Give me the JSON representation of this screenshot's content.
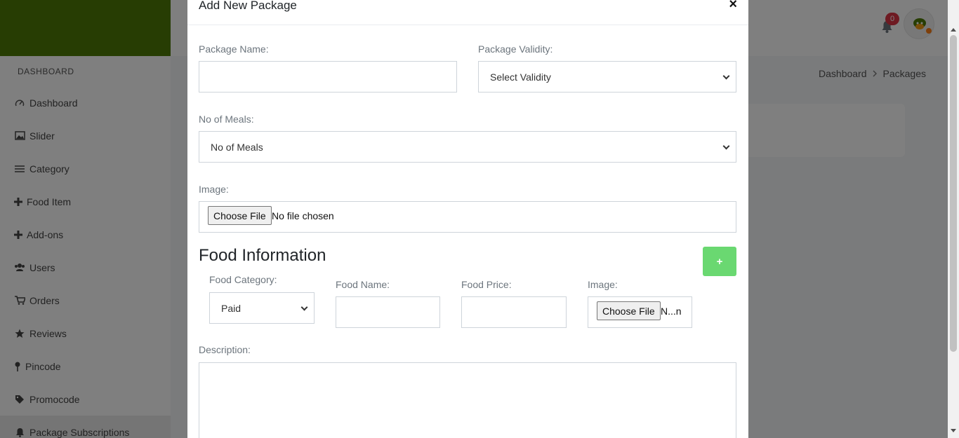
{
  "header": {
    "notification_count": "0",
    "breadcrumb": [
      "Dashboard",
      "Packages"
    ]
  },
  "sidebar": {
    "heading": "DASHBOARD",
    "items": [
      {
        "label": "Dashboard",
        "icon": "dashboard-icon"
      },
      {
        "label": "Slider",
        "icon": "image-icon"
      },
      {
        "label": "Category",
        "icon": "list-icon"
      },
      {
        "label": "Food Item",
        "icon": "plus-icon"
      },
      {
        "label": "Add-ons",
        "icon": "plus-icon"
      },
      {
        "label": "Users",
        "icon": "users-icon"
      },
      {
        "label": "Orders",
        "icon": "cart-icon"
      },
      {
        "label": "Reviews",
        "icon": "star-icon"
      },
      {
        "label": "Pincode",
        "icon": "map-pin-icon"
      },
      {
        "label": "Promocode",
        "icon": "tag-icon"
      },
      {
        "label": "Package Subscriptions",
        "icon": "bell-icon"
      }
    ]
  },
  "modal": {
    "title": "Add New Package",
    "close": "×",
    "package_name": {
      "label": "Package Name:",
      "value": ""
    },
    "package_validity": {
      "label": "Package Validity:",
      "selected": "Select Validity"
    },
    "no_of_meals": {
      "label": "No of Meals:",
      "selected": "No of Meals"
    },
    "image": {
      "label": "Image:",
      "button": "Choose File",
      "status": "No file chosen"
    },
    "food_information": {
      "title": "Food Information",
      "add_button": "+",
      "food_category": {
        "label": "Food Category:",
        "selected": "Paid"
      },
      "food_name": {
        "label": "Food Name:",
        "value": ""
      },
      "food_price": {
        "label": "Food Price:",
        "value": ""
      },
      "image": {
        "label": "Image:",
        "button": "Choose File",
        "status": "N...n"
      }
    },
    "description": {
      "label": "Description:",
      "value": ""
    }
  },
  "colors": {
    "brand_green": "#4e7b06",
    "add_button_green": "#6ad871",
    "badge_red": "#dc3545"
  }
}
